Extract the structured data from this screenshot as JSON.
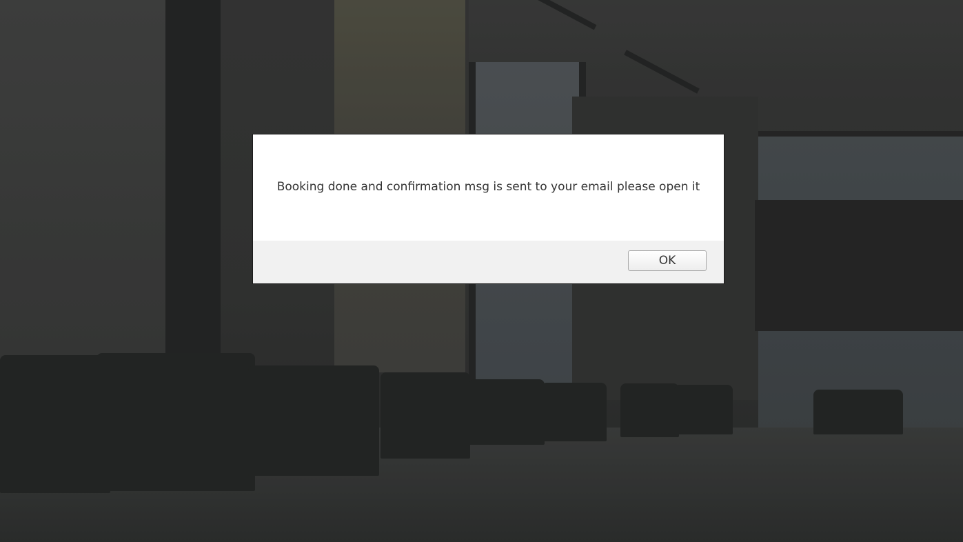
{
  "dialog": {
    "message": "Booking done and confirmation msg is sent to your email please open it",
    "ok_label": "OK"
  },
  "background": {
    "overlay_color": "#3a3b3a"
  }
}
